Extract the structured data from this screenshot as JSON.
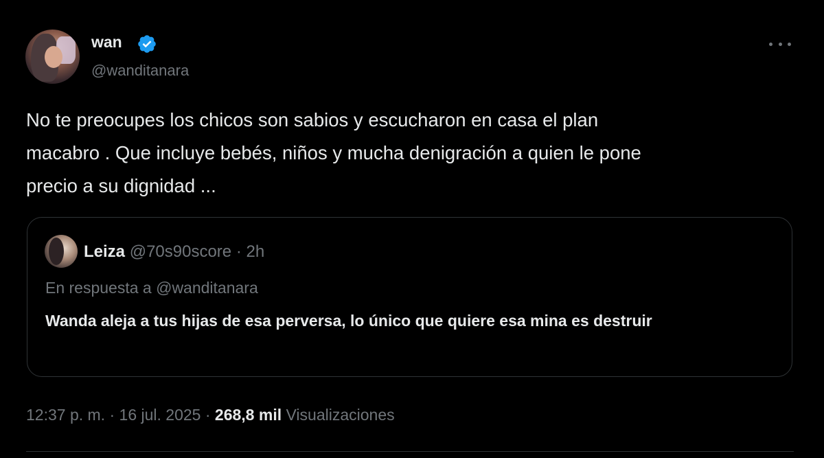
{
  "author": {
    "display_name": "wan",
    "handle": "@wanditanara",
    "verified": true
  },
  "tweet": {
    "text": "No te preocupes los chicos son sabios y escucharon en casa el plan\nmacabro . Que incluye bebés, niños y mucha denigración a quien le pone\nprecio a su dignidad ..."
  },
  "quote": {
    "name": "Leiza",
    "handle": "@70s90score",
    "separator": "·",
    "time": "2h",
    "reply_to": "En respuesta a @wanditanara",
    "text": "Wanda aleja a tus hijas de esa perversa, lo único que quiere esa mina es destruir"
  },
  "meta": {
    "time": "12:37 p. m.",
    "separator1": "·",
    "date": "16 jul. 2025",
    "separator2": "·",
    "views_count": "268,8 mil",
    "views_label": "Visualizaciones"
  },
  "colors": {
    "background": "#000000",
    "text": "#e7e9ea",
    "secondary": "#71767b",
    "verified": "#1d9bf0",
    "border": "#2f3336"
  },
  "icons": {
    "verified": "verified-badge-icon",
    "more": "more-dots-icon"
  }
}
